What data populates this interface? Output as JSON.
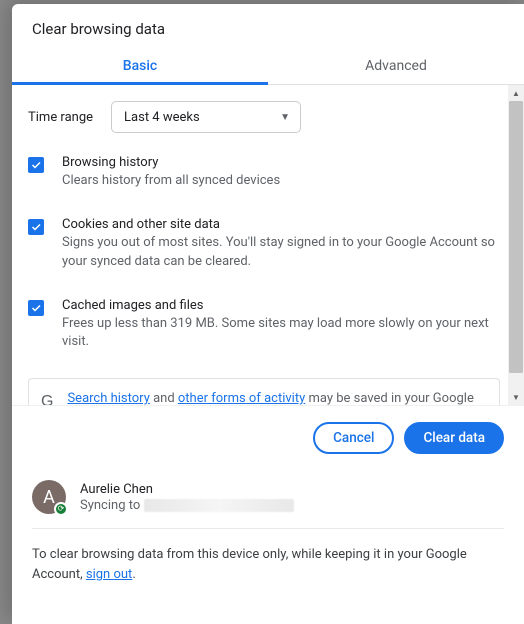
{
  "dialog": {
    "title": "Clear browsing data",
    "tabs": {
      "basic": "Basic",
      "advanced": "Advanced",
      "active": "basic"
    },
    "time_range": {
      "label": "Time range",
      "selected": "Last 4 weeks"
    },
    "options": [
      {
        "title": "Browsing history",
        "desc": "Clears history from all synced devices",
        "checked": true
      },
      {
        "title": "Cookies and other site data",
        "desc": "Signs you out of most sites. You'll stay signed in to your Google Account so your synced data can be cleared.",
        "checked": true
      },
      {
        "title": "Cached images and files",
        "desc": "Frees up less than 319 MB. Some sites may load more slowly on your next visit.",
        "checked": true
      }
    ],
    "info": {
      "link1": "Search history",
      "mid": " and ",
      "link2": "other forms of activity",
      "tail": " may be saved in your Google Account when you're signed in. You can delete them anytime."
    },
    "buttons": {
      "cancel": "Cancel",
      "clear": "Clear data"
    },
    "account": {
      "initial": "A",
      "name": "Aurelie Chen",
      "status_prefix": "Syncing to"
    },
    "footnote": {
      "pre": "To clear browsing data from this device only, while keeping it in your Google Account, ",
      "link": "sign out",
      "post": "."
    }
  }
}
